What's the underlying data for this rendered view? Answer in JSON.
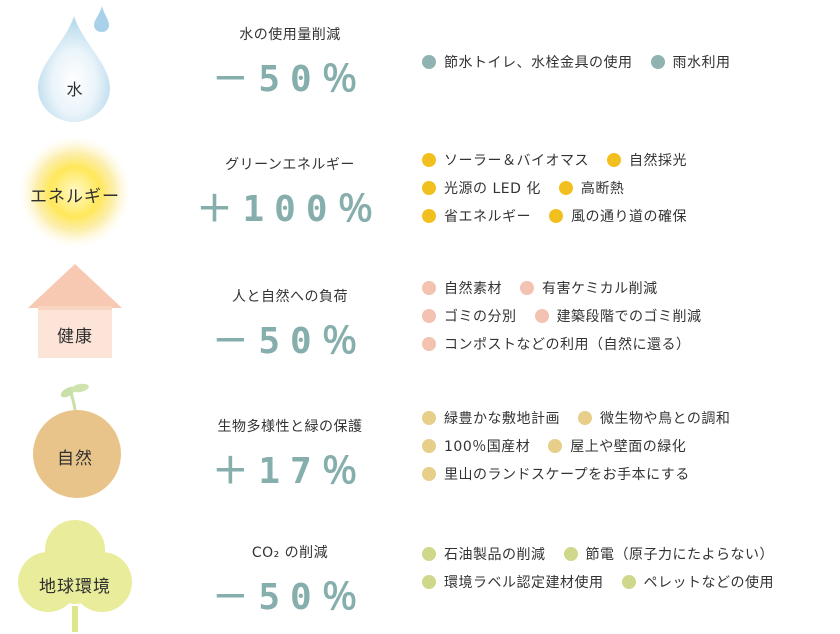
{
  "rows": [
    {
      "icon": "water-drop-icon",
      "icon_label": "水",
      "metric_label": "水の使用量削減",
      "metric_value": "－50％",
      "dot_color": "#8fb3b1",
      "items": [
        [
          "節水トイレ、水栓金具の使用",
          "雨水利用"
        ]
      ]
    },
    {
      "icon": "sun-icon",
      "icon_label": "エネルギー",
      "metric_label": "グリーンエネルギー",
      "metric_value": "＋100％",
      "dot_color": "#f2c01e",
      "items": [
        [
          "ソーラー＆バイオマス",
          "自然採光"
        ],
        [
          "光源の LED 化",
          "高断熱"
        ],
        [
          "省エネルギー",
          "風の通り道の確保"
        ]
      ]
    },
    {
      "icon": "house-icon",
      "icon_label": "健康",
      "metric_label": "人と自然への負荷",
      "metric_value": "－50％",
      "dot_color": "#f3c2b0",
      "items": [
        [
          "自然素材",
          "有害ケミカル削減"
        ],
        [
          "ゴミの分別",
          "建築段階でのゴミ削減"
        ],
        [
          "コンポストなどの利用（自然に還る）"
        ]
      ]
    },
    {
      "icon": "sprout-icon",
      "icon_label": "自然",
      "metric_label": "生物多様性と緑の保護",
      "metric_value": "＋17％",
      "dot_color": "#e7cf8a",
      "items": [
        [
          "緑豊かな敷地計画",
          "微生物や鳥との調和"
        ],
        [
          "100％国産材",
          "屋上や壁面の緑化"
        ],
        [
          "里山のランドスケープをお手本にする"
        ]
      ]
    },
    {
      "icon": "clover-tree-icon",
      "icon_label": "地球環境",
      "metric_label": "CO₂ の削減",
      "metric_value": "－50％",
      "dot_color": "#cfd88a",
      "items": [
        [
          "石油製品の削減",
          "節電（原子力にたよらない）"
        ],
        [
          "環境ラベル認定建材使用",
          "ペレットなどの使用"
        ]
      ]
    }
  ]
}
